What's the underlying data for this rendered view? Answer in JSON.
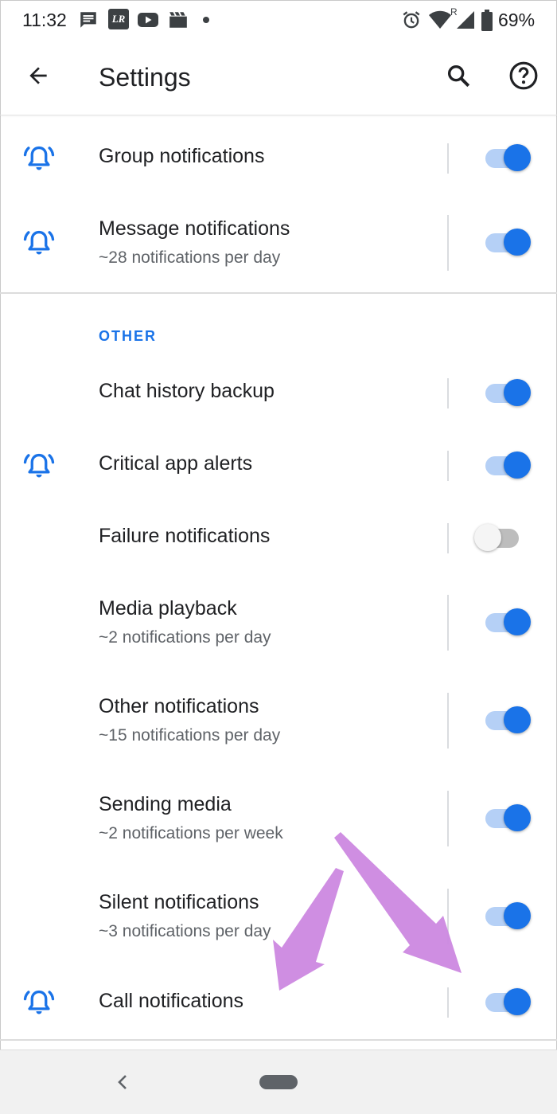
{
  "status_bar": {
    "time": "11:32",
    "battery_percent": "69%",
    "notification_icons": [
      "message-icon",
      "lr-app-icon",
      "youtube-icon",
      "clapperboard-icon",
      "dot-icon"
    ],
    "system_icons": [
      "alarm-icon",
      "wifi-icon",
      "signal-icon",
      "battery-icon"
    ],
    "lr_badge": "LR",
    "signal_roaming": "R"
  },
  "app_bar": {
    "title": "Settings",
    "back_icon": "arrow-back-icon",
    "search_icon": "search-icon",
    "help_icon": "help-icon"
  },
  "rows_top": [
    {
      "label": "Group notifications",
      "subtitle": "",
      "enabled": true,
      "bell": true
    },
    {
      "label": "Message notifications",
      "subtitle": "~28 notifications per day",
      "enabled": true,
      "bell": true
    }
  ],
  "section": {
    "header": "OTHER"
  },
  "rows_other": [
    {
      "label": "Chat history backup",
      "subtitle": "",
      "enabled": true,
      "bell": false
    },
    {
      "label": "Critical app alerts",
      "subtitle": "",
      "enabled": true,
      "bell": true
    },
    {
      "label": "Failure notifications",
      "subtitle": "",
      "enabled": false,
      "bell": false
    },
    {
      "label": "Media playback",
      "subtitle": "~2 notifications per day",
      "enabled": true,
      "bell": false
    },
    {
      "label": "Other notifications",
      "subtitle": "~15 notifications per day",
      "enabled": true,
      "bell": false
    },
    {
      "label": "Sending media",
      "subtitle": "~2 notifications per week",
      "enabled": true,
      "bell": false
    },
    {
      "label": "Silent notifications",
      "subtitle": "~3 notifications per day",
      "enabled": true,
      "bell": false
    },
    {
      "label": "Call notifications",
      "subtitle": "",
      "enabled": true,
      "bell": true
    }
  ],
  "colors": {
    "accent": "#1a73e8",
    "toggle_track_on": "#b5d0f6",
    "annotation_arrow": "#cc88e0"
  },
  "nav_bar": {
    "back_icon": "nav-back-icon",
    "home_icon": "home-pill-icon"
  }
}
